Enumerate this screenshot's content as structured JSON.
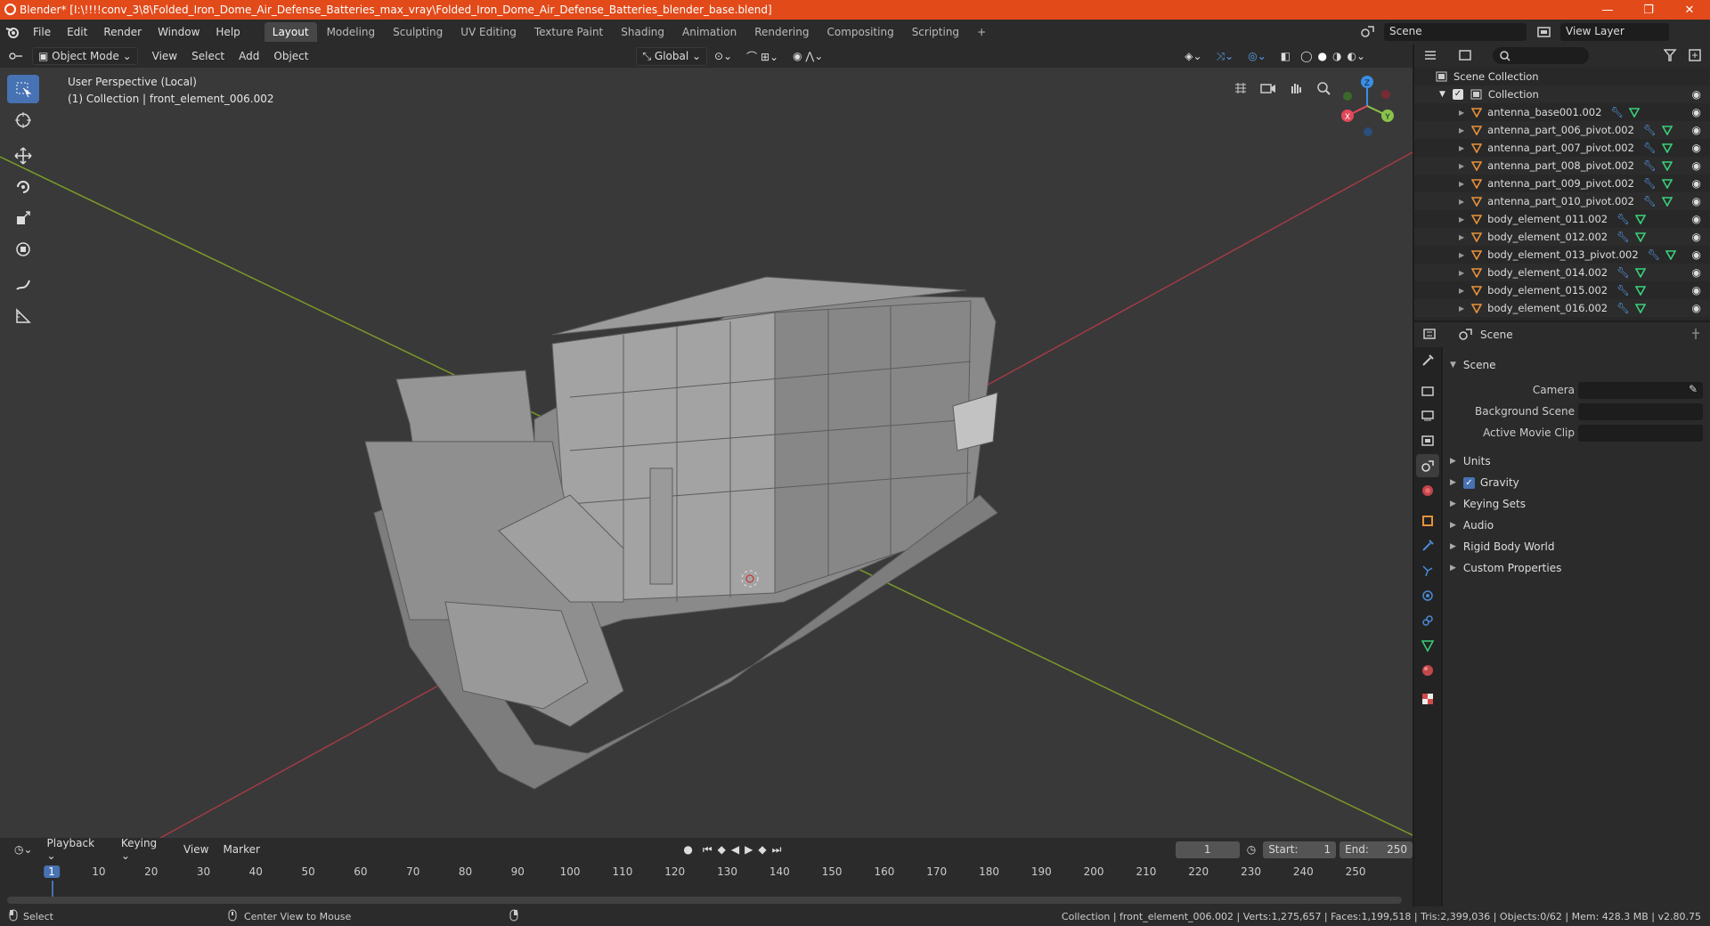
{
  "window": {
    "title": "Blender* [I:\\!!!!conv_3\\8\\Folded_Iron_Dome_Air_Defense_Batteries_max_vray\\Folded_Iron_Dome_Air_Defense_Batteries_blender_base.blend]",
    "minimize": "—",
    "maximize": "❐",
    "close": "✕"
  },
  "menus": [
    "File",
    "Edit",
    "Render",
    "Window",
    "Help"
  ],
  "workspaces": [
    "Layout",
    "Modeling",
    "Sculpting",
    "UV Editing",
    "Texture Paint",
    "Shading",
    "Animation",
    "Rendering",
    "Compositing",
    "Scripting"
  ],
  "add_workspace": "+",
  "scene_field": "Scene",
  "view_layer_field": "View Layer",
  "viewport": {
    "mode": "Object Mode",
    "menus": [
      "View",
      "Select",
      "Add",
      "Object"
    ],
    "orientation": "Global",
    "perspective_label": "User Perspective (Local)",
    "collection_label": "(1) Collection | front_element_006.002",
    "gizmo": {
      "z": "Z",
      "y": "Y",
      "x": "X"
    }
  },
  "timeline": {
    "menus": [
      "Playback",
      "Keying",
      "View",
      "Marker"
    ],
    "current_frame": "1",
    "start_label": "Start:",
    "start": "1",
    "end_label": "End:",
    "end": "250",
    "ticks": [
      "1",
      "10",
      "20",
      "30",
      "40",
      "50",
      "60",
      "70",
      "80",
      "90",
      "100",
      "110",
      "120",
      "130",
      "140",
      "150",
      "160",
      "170",
      "180",
      "190",
      "200",
      "210",
      "220",
      "230",
      "240",
      "250"
    ]
  },
  "outliner": {
    "root": "Scene Collection",
    "collection": "Collection",
    "items": [
      "antenna_base001.002",
      "antenna_part_006_pivot.002",
      "antenna_part_007_pivot.002",
      "antenna_part_008_pivot.002",
      "antenna_part_009_pivot.002",
      "antenna_part_010_pivot.002",
      "body_element_011.002",
      "body_element_012.002",
      "body_element_013_pivot.002",
      "body_element_014.002",
      "body_element_015.002",
      "body_element_016.002"
    ]
  },
  "properties": {
    "header": "Scene",
    "section": "Scene",
    "camera_label": "Camera",
    "background_label": "Background Scene",
    "movie_clip_label": "Active Movie Clip",
    "panels": [
      "Units",
      "Gravity",
      "Keying Sets",
      "Audio",
      "Rigid Body World",
      "Custom Properties"
    ]
  },
  "status": {
    "select": "Select",
    "center": "Center View to Mouse",
    "stats": "Collection | front_element_006.002 | Verts:1,275,657 | Faces:1,199,518 | Tris:2,399,036 | Objects:0/62 | Mem: 428.3 MB | v2.80.75"
  },
  "colors": {
    "title_bar": "#e24a1a",
    "accent": "#4772b3",
    "x_axis": "#e2475b",
    "y_axis": "#8bc34a",
    "z_axis": "#3a8ee6",
    "object_icon": "#e8913a"
  }
}
